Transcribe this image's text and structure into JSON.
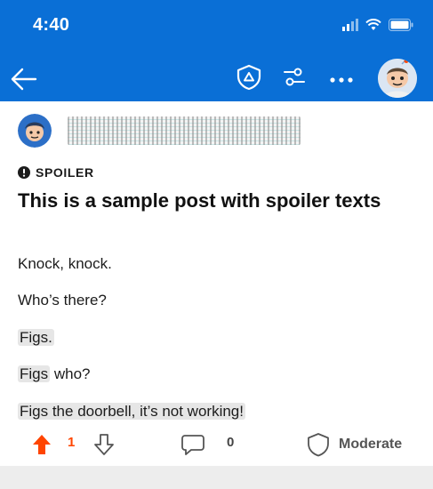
{
  "status_bar": {
    "time": "4:40"
  },
  "nav": {
    "back_icon": "arrow-left-icon",
    "mod_icon": "shield-triangle-icon",
    "filter_icon": "sliders-icon",
    "more_icon": "more-horizontal-icon",
    "avatar_icon": "user-avatar"
  },
  "post": {
    "flair": "SPOILER",
    "title": "This is a sample post with spoiler texts",
    "lines": [
      {
        "before": "",
        "spoiler": "",
        "text": "Knock, knock."
      },
      {
        "before": "",
        "spoiler": "",
        "text": "Who’s there?"
      },
      {
        "before": "",
        "spoiler": "Figs.",
        "text": ""
      },
      {
        "before": "",
        "spoiler": "Figs",
        "text": " who?"
      },
      {
        "before": "",
        "spoiler": "Figs the doorbell, it’s not working!",
        "text": ""
      }
    ]
  },
  "actions": {
    "vote_count": "1",
    "comment_count": "0",
    "moderate_label": "Moderate"
  },
  "colors": {
    "header_blue": "#0a6fd6",
    "upvote_orange": "#ff4500",
    "spoiler_bg": "#e6e6e6"
  }
}
